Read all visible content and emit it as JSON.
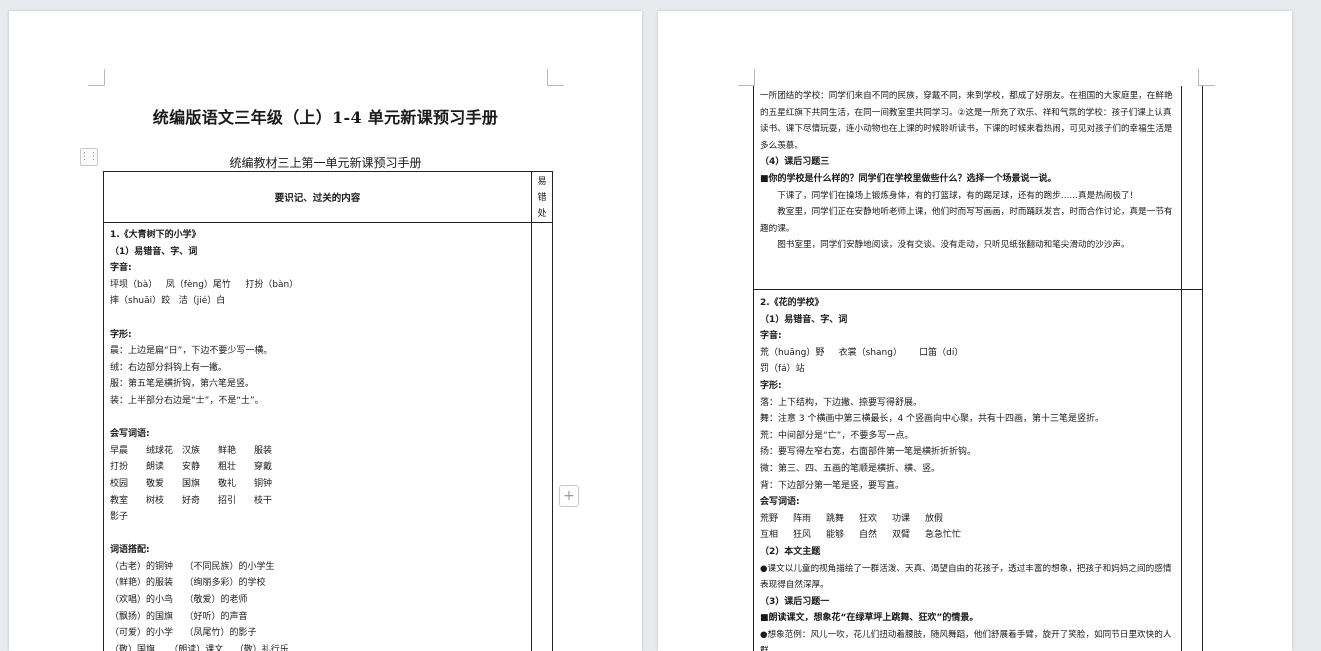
{
  "left_page": {
    "title": "统编版语文三年级（上）1-4 单元新课预习手册",
    "table_caption": "统编教材三上第一单元新课预习手册",
    "header": {
      "main": "要识记、过关的内容",
      "side": [
        "易",
        "错",
        "处"
      ]
    },
    "lines": [
      {
        "t": "1.《大青树下的小学》",
        "b": true
      },
      {
        "t": "（1）易错音、字、词",
        "b": true
      },
      {
        "t": "字音:",
        "b": true
      },
      {
        "t": "坪坝（bà）   凤（fèng）尾竹     打扮（bàn）"
      },
      {
        "t": "摔（shuāi）跤   洁（jié）白"
      },
      {
        "t": ""
      },
      {
        "t": "字形:",
        "b": true
      },
      {
        "t": "晨：上边是扁“日”，下边不要少写一横。"
      },
      {
        "t": "绒：右边部分斜钩上有一撇。"
      },
      {
        "t": "服：第五笔是横折钩，第六笔是竖。"
      },
      {
        "t": "装：上半部分右边是“士”，不是“土”。"
      },
      {
        "t": ""
      },
      {
        "t": "会写词语:",
        "b": true
      }
    ],
    "word_rows": [
      [
        "早晨",
        "绒球花",
        "汉族",
        "鲜艳",
        "服装"
      ],
      [
        "打扮",
        "朗读",
        "安静",
        "粗壮",
        "穿戴"
      ],
      [
        "校园",
        "敬爱",
        "国旗",
        "敬礼",
        "铜钟"
      ],
      [
        "教室",
        "树枝",
        "好奇",
        "招引",
        "枝干"
      ],
      [
        "影子"
      ]
    ],
    "lines2": [
      {
        "t": ""
      },
      {
        "t": "词语搭配:",
        "b": true
      },
      {
        "t": "（古老）的铜钟    （不同民族）的小学生"
      },
      {
        "t": "（鲜艳）的服装    （绚丽多彩）的学校"
      },
      {
        "t": "（欢唱）的小鸟    （敬爱）的老师"
      },
      {
        "t": "（飘扬）的国旗    （好听）的声音"
      },
      {
        "t": "（可爱）的小学    （凤尾竹）的影子"
      },
      {
        "t": "（敬）国旗     （朗读）课文    （敬）礼行乐"
      }
    ],
    "add_icon": "+",
    "drag_icon": "⋮⋮"
  },
  "right_page": {
    "top_paras": [
      "一所团结的学校：同学们来自不同的民族，穿戴不同，来到学校，都成了好朋友。在祖国的大家庭里，在鲜艳的五星红旗下共同生活，在同一间教室里共同学习。②这是一所充了欢乐、祥和气氛的学校：孩子们课上认真读书、课下尽情玩耍，连小动物也在上课的时候聆听读书，下课的时候来看热闹，可见对孩子们的幸福生活是多么羡慕。"
    ],
    "exercise_title": "（4）课后习题三",
    "exercise_question": "■你的学校是什么样的？同学们在学校里做些什么？选择一个场景说一说。",
    "answers": [
      "下课了，同学们在操场上锻炼身体，有的打篮球，有的踢足球，还有的跑步……真是热闹极了！",
      "教室里，同学们正在安静地听老师上课，他们时而写写画画，时而踊跃发言，时而合作讨论，真是一节有趣的课。",
      "图书室里，同学们安静地阅读，没有交谈、没有走动，只听见纸张翻动和笔尖滑动的沙沙声。"
    ],
    "section2": [
      {
        "t": "2.《花的学校》",
        "b": true
      },
      {
        "t": "（1）易错音、字、词",
        "b": true
      },
      {
        "t": "字音:",
        "b": true
      },
      {
        "t": "荒（huāng）野     衣裳（shang）      口笛（dí）"
      },
      {
        "t": "罚（fá）站"
      },
      {
        "t": "字形:",
        "b": true
      },
      {
        "t": "落：上下结构，下边撇、捺要写得舒展。"
      },
      {
        "t": "舞：注意 3 个横画中第三横最长，4 个竖画向中心聚，共有十四画，第十三笔是竖折。"
      },
      {
        "t": "荒：中间部分是“亡”，不要多写一点。"
      },
      {
        "t": "扬：要写得左窄右宽，右面部件第一笔是横折折折钩。"
      },
      {
        "t": "微：第三、四、五画的笔顺是横折、横、竖。"
      },
      {
        "t": "背：下边部分第一笔是竖，要写直。"
      },
      {
        "t": "会写词语:",
        "b": true
      }
    ],
    "word_rows": [
      [
        "荒野",
        "阵雨",
        "跳舞",
        "狂欢",
        "功课",
        "放假"
      ],
      [
        "互相",
        "狂风",
        "能够",
        "自然",
        "双臂",
        "急急忙忙"
      ]
    ],
    "section2b": [
      {
        "t": "（2）本文主题",
        "b": true
      },
      {
        "t": "●课文以儿童的视角描绘了一群活泼、天真、渴望自由的花孩子，透过丰富的想象，把孩子和妈妈之间的感情表现得自然深厚。",
        "wrap": true
      },
      {
        "t": "（3）课后习题一",
        "b": true
      },
      {
        "t": "■朗读课文，想象花“在绿草坪上跳舞、狂欢”的情景。",
        "b": true
      },
      {
        "t": "●想象范例：风儿一吹，花儿们扭动着腰肢，随风舞蹈，他们舒展着手臂，旋开了笑脸，如同节日里欢快的人群。",
        "wrap": true,
        "leadbold": "●想象范例："
      }
    ]
  }
}
